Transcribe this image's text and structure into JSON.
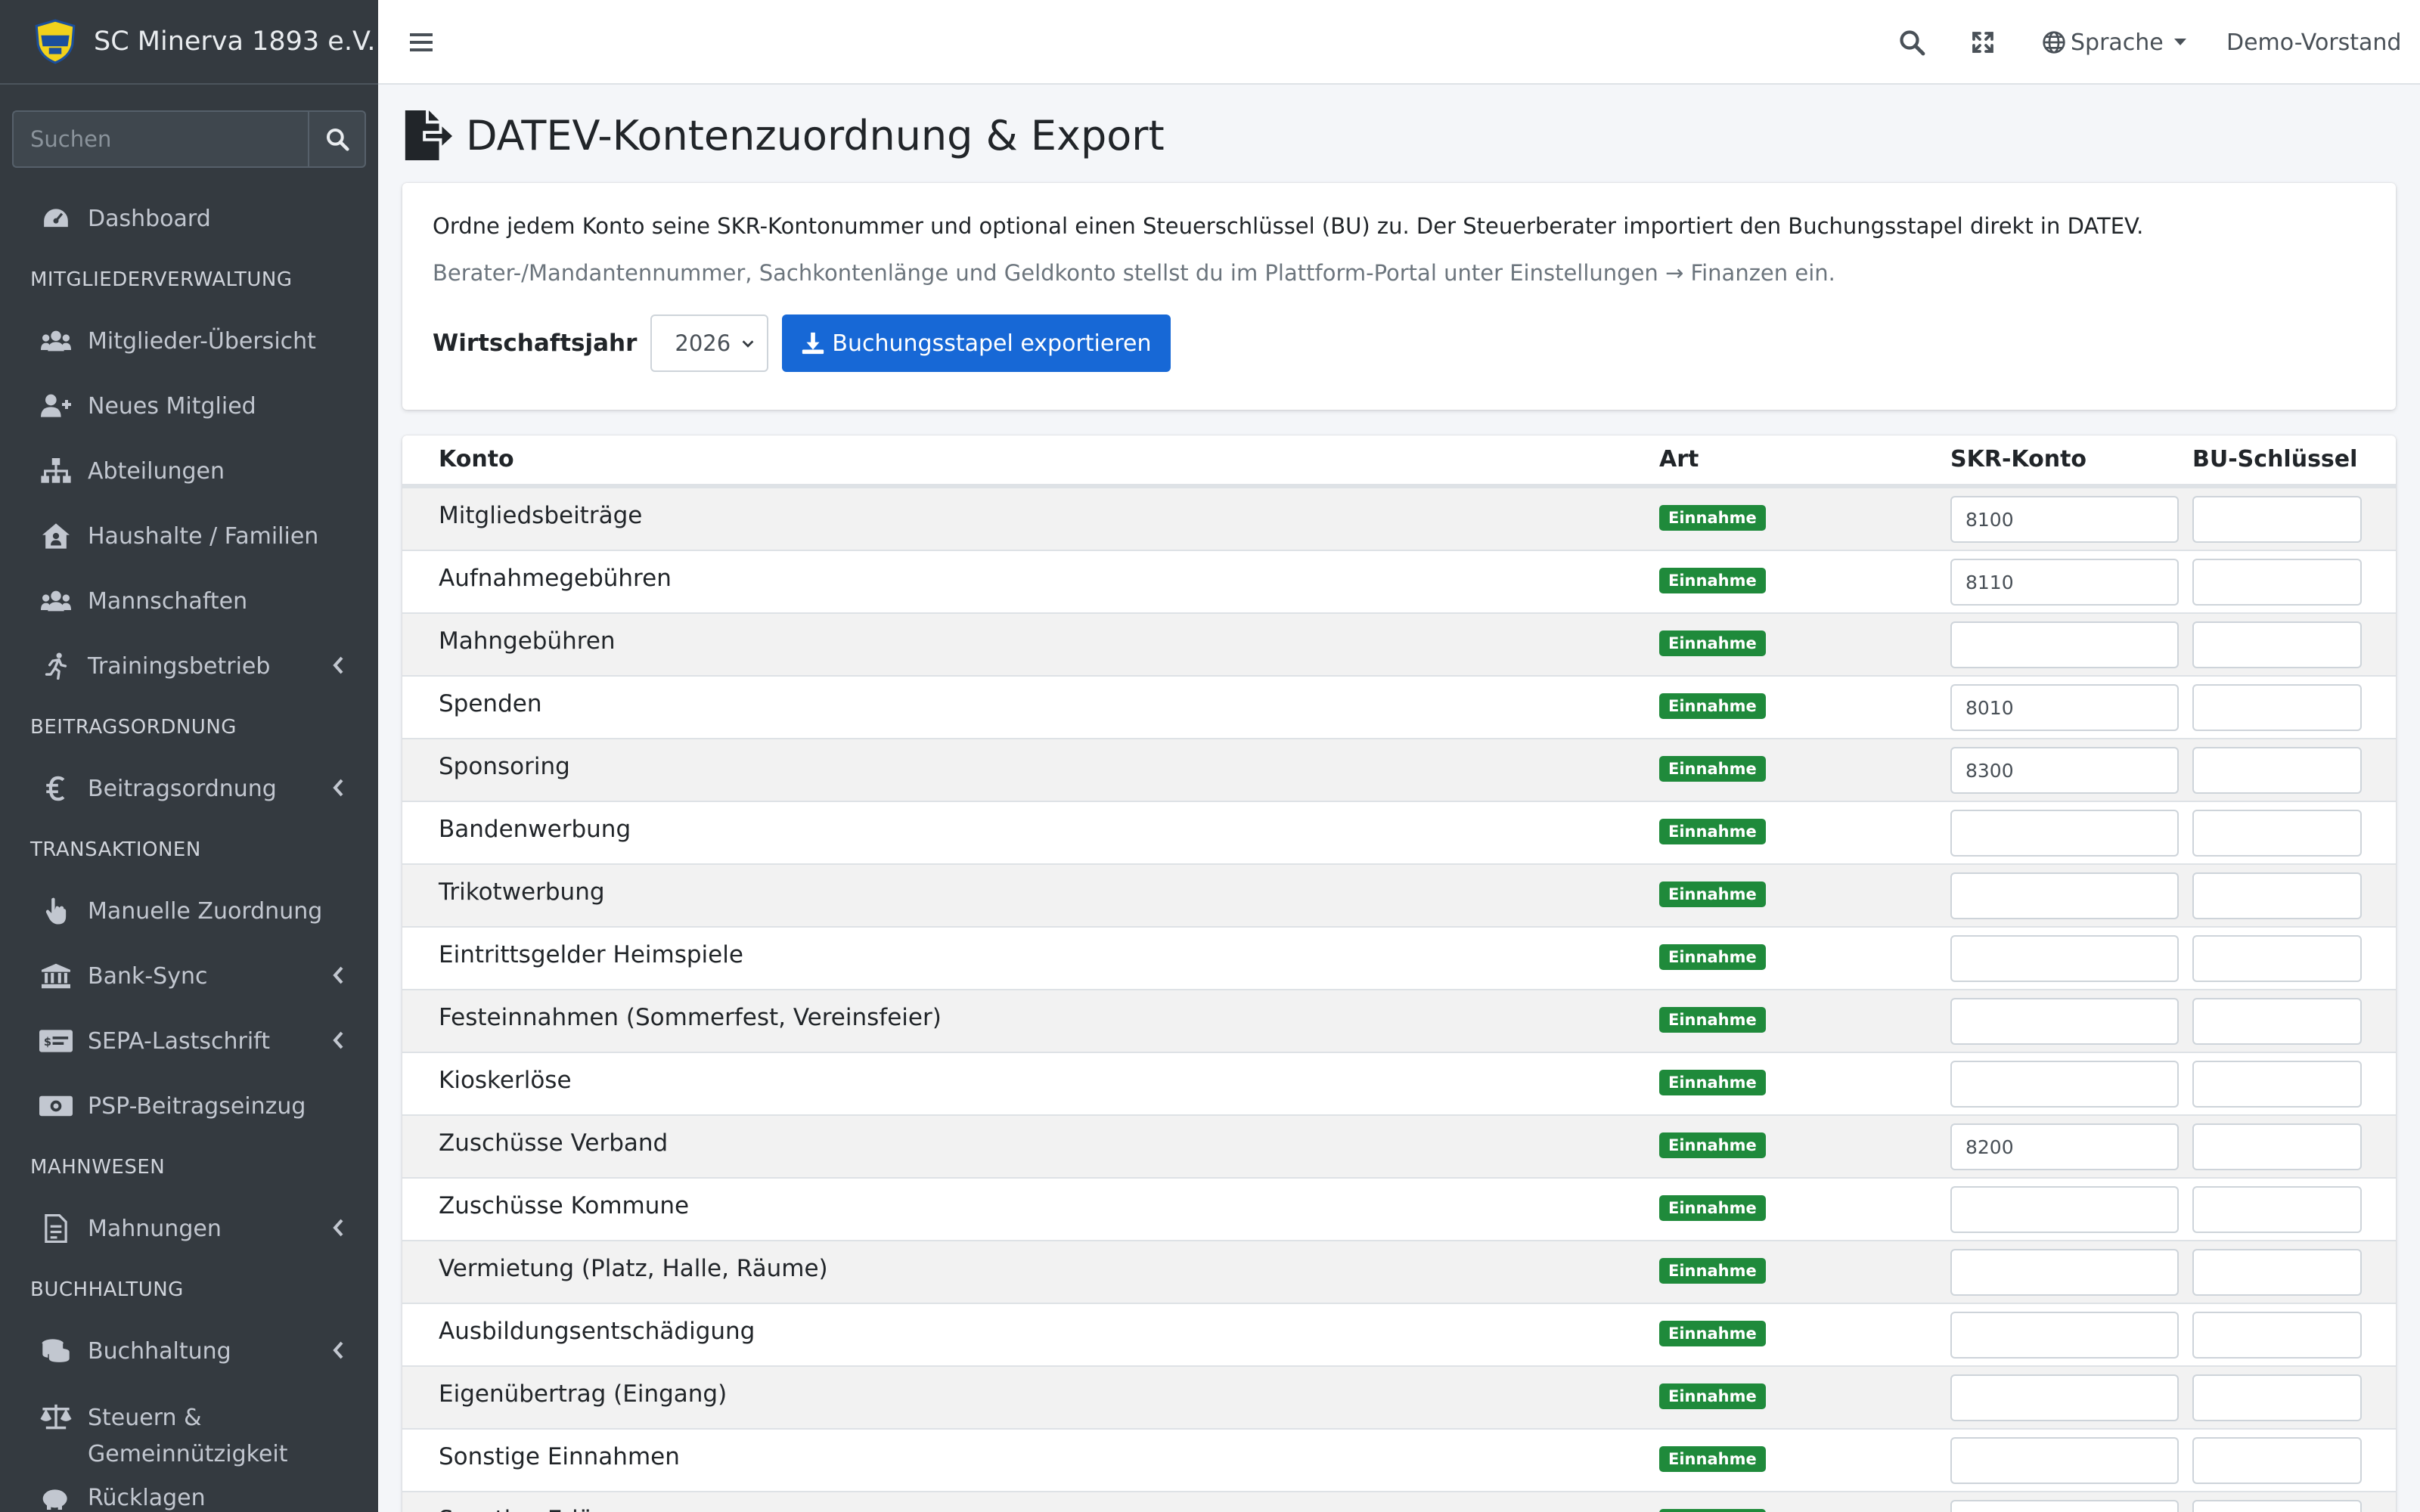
{
  "brand": {
    "name": "SC Minerva 1893 e.V."
  },
  "sidebar": {
    "search_placeholder": "Suchen",
    "sections": [
      {
        "type": "item",
        "label": "Dashboard",
        "icon": "tachometer-icon",
        "chevron": false
      },
      {
        "type": "header",
        "label": "MITGLIEDERVERWALTUNG"
      },
      {
        "type": "item",
        "label": "Mitglieder-Übersicht",
        "icon": "users-icon",
        "chevron": false
      },
      {
        "type": "item",
        "label": "Neues Mitglied",
        "icon": "user-plus-icon",
        "chevron": false
      },
      {
        "type": "item",
        "label": "Abteilungen",
        "icon": "sitemap-icon",
        "chevron": false
      },
      {
        "type": "item",
        "label": "Haushalte / Familien",
        "icon": "house-user-icon",
        "chevron": false
      },
      {
        "type": "item",
        "label": "Mannschaften",
        "icon": "users-icon",
        "chevron": false
      },
      {
        "type": "item",
        "label": "Trainingsbetrieb",
        "icon": "running-icon",
        "chevron": true
      },
      {
        "type": "header",
        "label": "BEITRAGSORDNUNG"
      },
      {
        "type": "item",
        "label": "Beitragsordnung",
        "icon": "euro-icon",
        "chevron": true
      },
      {
        "type": "header",
        "label": "TRANSAKTIONEN"
      },
      {
        "type": "item",
        "label": "Manuelle Zuordnung",
        "icon": "hand-pointer-icon",
        "chevron": false
      },
      {
        "type": "item",
        "label": "Bank-Sync",
        "icon": "bank-icon",
        "chevron": true
      },
      {
        "type": "item",
        "label": "SEPA-Lastschrift",
        "icon": "money-check-icon",
        "chevron": true
      },
      {
        "type": "item",
        "label": "PSP-Beitragseinzug",
        "icon": "money-bill-icon",
        "chevron": false
      },
      {
        "type": "header",
        "label": "MAHNWESEN"
      },
      {
        "type": "item",
        "label": "Mahnungen",
        "icon": "file-invoice-icon",
        "chevron": true
      },
      {
        "type": "header",
        "label": "BUCHHALTUNG"
      },
      {
        "type": "item",
        "label": "Buchhaltung",
        "icon": "coins-icon",
        "chevron": true
      },
      {
        "type": "item",
        "label": "Steuern & Gemeinnützigkeit",
        "icon": "balance-scale-icon",
        "chevron": false,
        "tall": true
      },
      {
        "type": "item",
        "label": "Rücklagen",
        "icon": "piggy-bank-icon",
        "chevron": false
      }
    ]
  },
  "topbar": {
    "language_label": "Sprache",
    "user_label": "Demo-Vorstand"
  },
  "page": {
    "title": "DATEV-Kontenzuordnung & Export",
    "info_line1": "Ordne jedem Konto seine SKR-Kontonummer und optional einen Steuerschlüssel (BU) zu. Der Steuerberater importiert den Buchungsstapel direkt in DATEV.",
    "info_line2": "Berater-/Mandantennummer, Sachkontenlänge und Geldkonto stellst du im Plattform-Portal unter Einstellungen → Finanzen ein.",
    "fiscal_year_label": "Wirtschaftsjahr",
    "fiscal_year_value": "2026",
    "export_button": "Buchungsstapel exportieren"
  },
  "table": {
    "headers": {
      "konto": "Konto",
      "art": "Art",
      "skr": "SKR-Konto",
      "bu": "BU-Schlüssel"
    },
    "rows": [
      {
        "name": "Mitgliedsbeiträge",
        "art": "Einnahme",
        "skr": "8100",
        "bu": ""
      },
      {
        "name": "Aufnahmegebühren",
        "art": "Einnahme",
        "skr": "8110",
        "bu": ""
      },
      {
        "name": "Mahngebühren",
        "art": "Einnahme",
        "skr": "",
        "bu": ""
      },
      {
        "name": "Spenden",
        "art": "Einnahme",
        "skr": "8010",
        "bu": ""
      },
      {
        "name": "Sponsoring",
        "art": "Einnahme",
        "skr": "8300",
        "bu": ""
      },
      {
        "name": "Bandenwerbung",
        "art": "Einnahme",
        "skr": "",
        "bu": ""
      },
      {
        "name": "Trikotwerbung",
        "art": "Einnahme",
        "skr": "",
        "bu": ""
      },
      {
        "name": "Eintrittsgelder Heimspiele",
        "art": "Einnahme",
        "skr": "",
        "bu": ""
      },
      {
        "name": "Festeinnahmen (Sommerfest, Vereinsfeier)",
        "art": "Einnahme",
        "skr": "",
        "bu": ""
      },
      {
        "name": "Kioskerlöse",
        "art": "Einnahme",
        "skr": "",
        "bu": ""
      },
      {
        "name": "Zuschüsse Verband",
        "art": "Einnahme",
        "skr": "8200",
        "bu": ""
      },
      {
        "name": "Zuschüsse Kommune",
        "art": "Einnahme",
        "skr": "",
        "bu": ""
      },
      {
        "name": "Vermietung (Platz, Halle, Räume)",
        "art": "Einnahme",
        "skr": "",
        "bu": ""
      },
      {
        "name": "Ausbildungsentschädigung",
        "art": "Einnahme",
        "skr": "",
        "bu": ""
      },
      {
        "name": "Eigenübertrag (Eingang)",
        "art": "Einnahme",
        "skr": "",
        "bu": ""
      },
      {
        "name": "Sonstige Einnahmen",
        "art": "Einnahme",
        "skr": "",
        "bu": ""
      },
      {
        "name": "Sonstige Erlöse",
        "art": "Einnahme",
        "skr": "",
        "bu": ""
      }
    ]
  }
}
